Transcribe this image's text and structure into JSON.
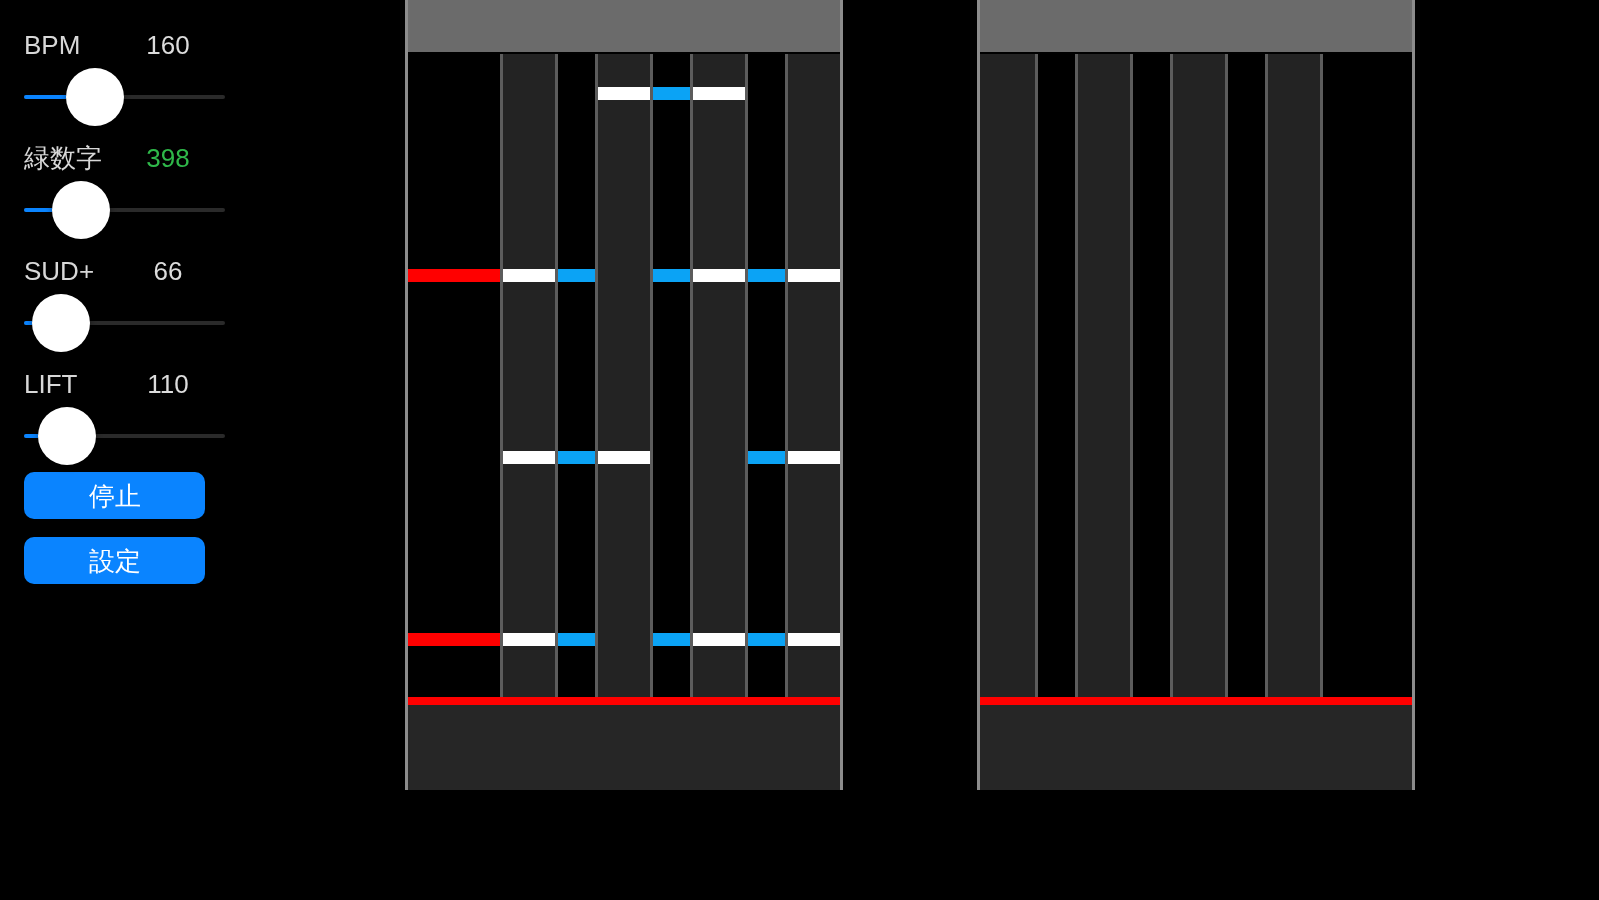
{
  "settings": [
    {
      "label": "BPM",
      "value": "160",
      "color": "#dcdcdc",
      "level": 0.21
    },
    {
      "label": "緑数字",
      "value": "398",
      "color": "#2fb84a",
      "level": 0.14
    },
    {
      "label": "SUD+",
      "value": "66",
      "color": "#dcdcdc",
      "level": 0.04
    },
    {
      "label": "LIFT",
      "value": "110",
      "color": "#dcdcdc",
      "level": 0.07
    }
  ],
  "buttons": [
    {
      "label": "停止"
    },
    {
      "label": "設定"
    }
  ],
  "playfields": [
    {
      "lanes": [
        {
          "kind": "scratch",
          "notes": [
            false,
            true,
            false,
            true
          ]
        },
        {
          "kind": "white_key",
          "notes": [
            false,
            true,
            true,
            true
          ]
        },
        {
          "kind": "black_key",
          "notes": [
            false,
            true,
            true,
            true
          ]
        },
        {
          "kind": "white_key",
          "notes": [
            true,
            false,
            true,
            false
          ]
        },
        {
          "kind": "black_key",
          "notes": [
            true,
            true,
            false,
            true
          ]
        },
        {
          "kind": "white_key",
          "notes": [
            true,
            true,
            false,
            true
          ]
        },
        {
          "kind": "black_key",
          "notes": [
            false,
            true,
            true,
            true
          ]
        },
        {
          "kind": "white_key",
          "notes": [
            false,
            true,
            true,
            true
          ]
        }
      ]
    },
    {
      "lanes": [
        {
          "kind": "white_key"
        },
        {
          "kind": "black_key"
        },
        {
          "kind": "white_key"
        },
        {
          "kind": "black_key"
        },
        {
          "kind": "white_key"
        },
        {
          "kind": "black_key"
        },
        {
          "kind": "white_key"
        },
        {
          "kind": "scratch"
        }
      ]
    }
  ]
}
